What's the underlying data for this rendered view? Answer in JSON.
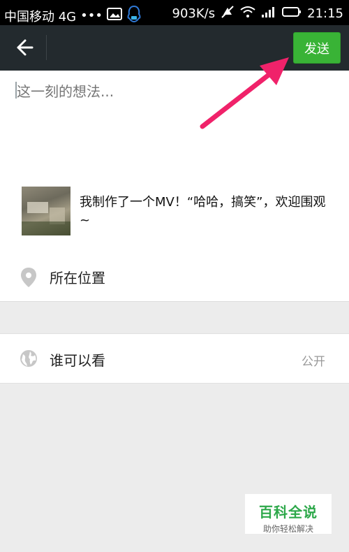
{
  "status_bar": {
    "carrier": "中国移动 4G",
    "dots": "•••",
    "speed": "903K/s",
    "time": "21:15"
  },
  "header": {
    "send_label": "发送"
  },
  "compose": {
    "placeholder": "这一刻的想法..."
  },
  "share_card": {
    "text": "我制作了一个MV！“哈哈，搞笑”，欢迎围观~"
  },
  "location": {
    "label": "所在位置",
    "icon": "location-pin-icon"
  },
  "visibility": {
    "label": "谁可以看",
    "value": "公开",
    "icon": "globe-icon"
  },
  "watermark": {
    "title": "百科全说",
    "subtitle": "助你轻松解决"
  },
  "colors": {
    "header_bg": "#232a2e",
    "send_button": "#39b336",
    "annotation_arrow": "#f0226a"
  }
}
